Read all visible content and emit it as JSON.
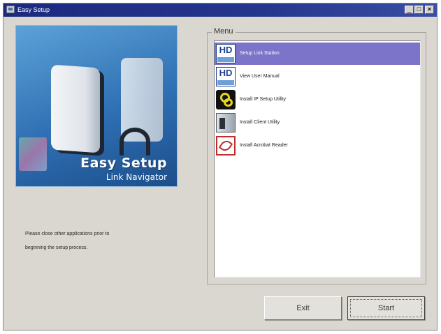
{
  "window": {
    "title": "Easy Setup",
    "controls": {
      "minimize": "_",
      "maximize": "□",
      "close": "×"
    }
  },
  "hero": {
    "title": "Easy Setup",
    "subtitle": "Link Navigator"
  },
  "info": {
    "line1": "Please close other applications prior to",
    "line2": "beginning the setup process."
  },
  "menu": {
    "legend": "Menu",
    "selected_color": "#7b74c9",
    "items": [
      {
        "label": "Setup Link Station",
        "icon": "hd-icon",
        "icon_text": "HD",
        "selected": true
      },
      {
        "label": "View User Manual",
        "icon": "hd-icon",
        "icon_text": "HD",
        "selected": false
      },
      {
        "label": "Install IP Setup Utility",
        "icon": "ip-setup-icon",
        "selected": false
      },
      {
        "label": "Install Client Utility",
        "icon": "client-utility-icon",
        "selected": false
      },
      {
        "label": "Install Acrobat Reader",
        "icon": "acrobat-icon",
        "selected": false
      }
    ]
  },
  "buttons": {
    "exit": "Exit",
    "start": "Start"
  }
}
